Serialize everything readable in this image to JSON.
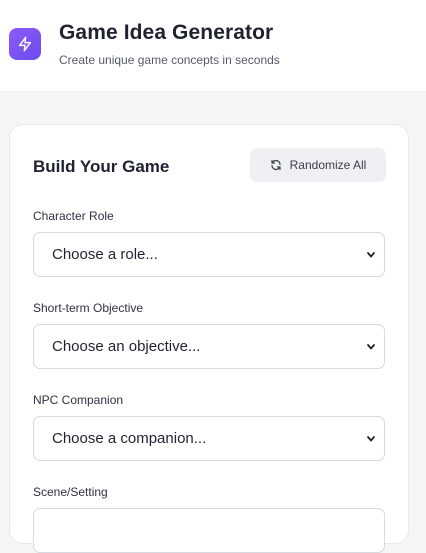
{
  "header": {
    "title": "Game Idea Generator",
    "subtitle": "Create unique game concepts in seconds",
    "logo_icon": "lightning-bolt-icon",
    "accent_color": "#7c5cf2"
  },
  "builder": {
    "title": "Build Your Game",
    "randomize_label": "Randomize All",
    "fields": [
      {
        "label": "Character Role",
        "value": "Choose a role..."
      },
      {
        "label": "Short-term Objective",
        "value": "Choose an objective..."
      },
      {
        "label": "NPC Companion",
        "value": "Choose a companion..."
      },
      {
        "label": "Scene/Setting",
        "value": ""
      }
    ]
  }
}
